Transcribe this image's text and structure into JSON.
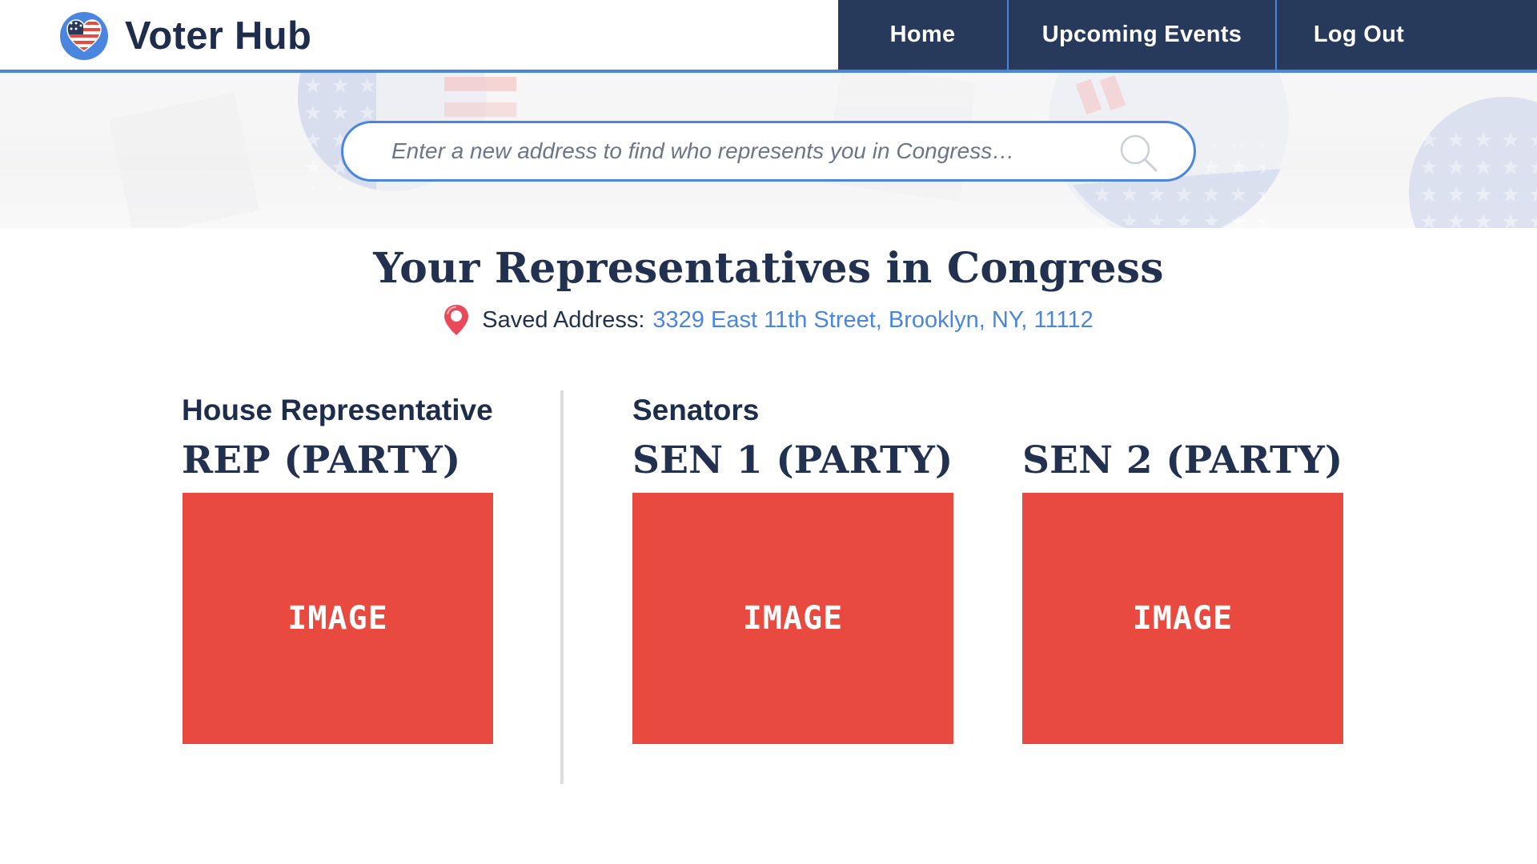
{
  "brand": {
    "name": "Voter Hub",
    "logo": "heart-flag-icon"
  },
  "nav": {
    "items": [
      {
        "label": "Home"
      },
      {
        "label": "Upcoming Events"
      },
      {
        "label": "Log Out"
      }
    ]
  },
  "search": {
    "placeholder": "Enter a new address to find who represents you in Congress…",
    "value": "",
    "icon": "magnifier-icon"
  },
  "main": {
    "title": "Your Representatives in Congress",
    "saved_address_label": "Saved Address:",
    "saved_address_value": "3329 East 11th Street, Brooklyn, NY, 11112",
    "pin_icon": "map-pin-icon"
  },
  "house": {
    "heading": "House Representative",
    "rep": {
      "name": "REP (PARTY)",
      "image_label": "IMAGE"
    }
  },
  "senate": {
    "heading": "Senators",
    "senators": [
      {
        "name": "SEN 1 (PARTY)",
        "image_label": "IMAGE"
      },
      {
        "name": "SEN 2 (PARTY)",
        "image_label": "IMAGE"
      }
    ]
  },
  "colors": {
    "navy": "#283a5c",
    "accent_blue": "#4a86e0",
    "image_red": "#e84a3f",
    "text_dark": "#22314f"
  }
}
